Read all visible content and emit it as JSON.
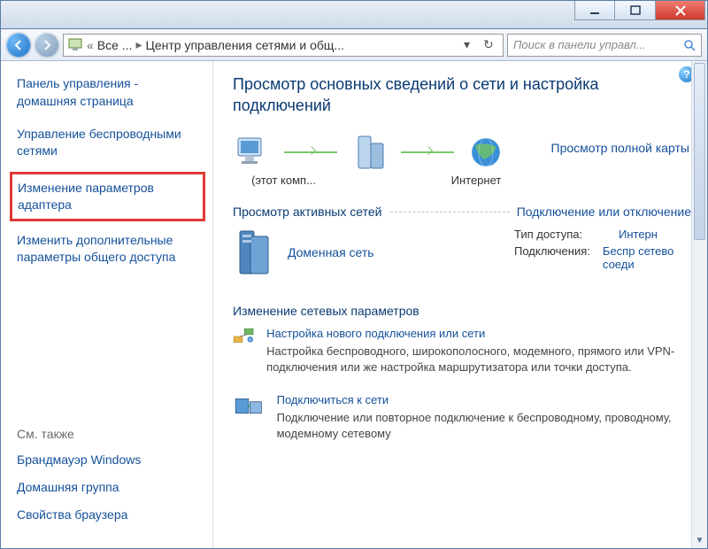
{
  "breadcrumb": {
    "root": "Все ...",
    "page": "Центр управления сетями и общ...",
    "chevrons": "«"
  },
  "search": {
    "placeholder": "Поиск в панели управл..."
  },
  "sidebar": {
    "home": "Панель управления - домашняя страница",
    "links": [
      "Управление беспроводными сетями",
      "Изменение параметров адаптера",
      "Изменить дополнительные параметры общего доступа"
    ],
    "see_also_title": "См. также",
    "see_also": [
      "Брандмауэр Windows",
      "Домашняя группа",
      "Свойства браузера"
    ]
  },
  "main": {
    "heading": "Просмотр основных сведений о сети и настройка подключений",
    "full_map": "Просмотр полной карты",
    "map": {
      "this_computer": "(этот комп...",
      "internet": "Интернет"
    },
    "active_title": "Просмотр активных сетей",
    "active_link": "Подключение или отключение",
    "network": {
      "name": "Доменная сеть",
      "access_type_label": "Тип доступа:",
      "access_type_value": "Интерн",
      "connections_label": "Подключения:",
      "connections_value": "Беспр сетево соеди"
    },
    "change_title": "Изменение сетевых параметров",
    "change_items": [
      {
        "title": "Настройка нового подключения или сети",
        "desc": "Настройка беспроводного, широкополосного, модемного, прямого или VPN-подключения или же настройка маршрутизатора или точки доступа."
      },
      {
        "title": "Подключиться к сети",
        "desc": "Подключение или повторное подключение к беспроводному, проводному, модемному сетевому"
      }
    ]
  }
}
